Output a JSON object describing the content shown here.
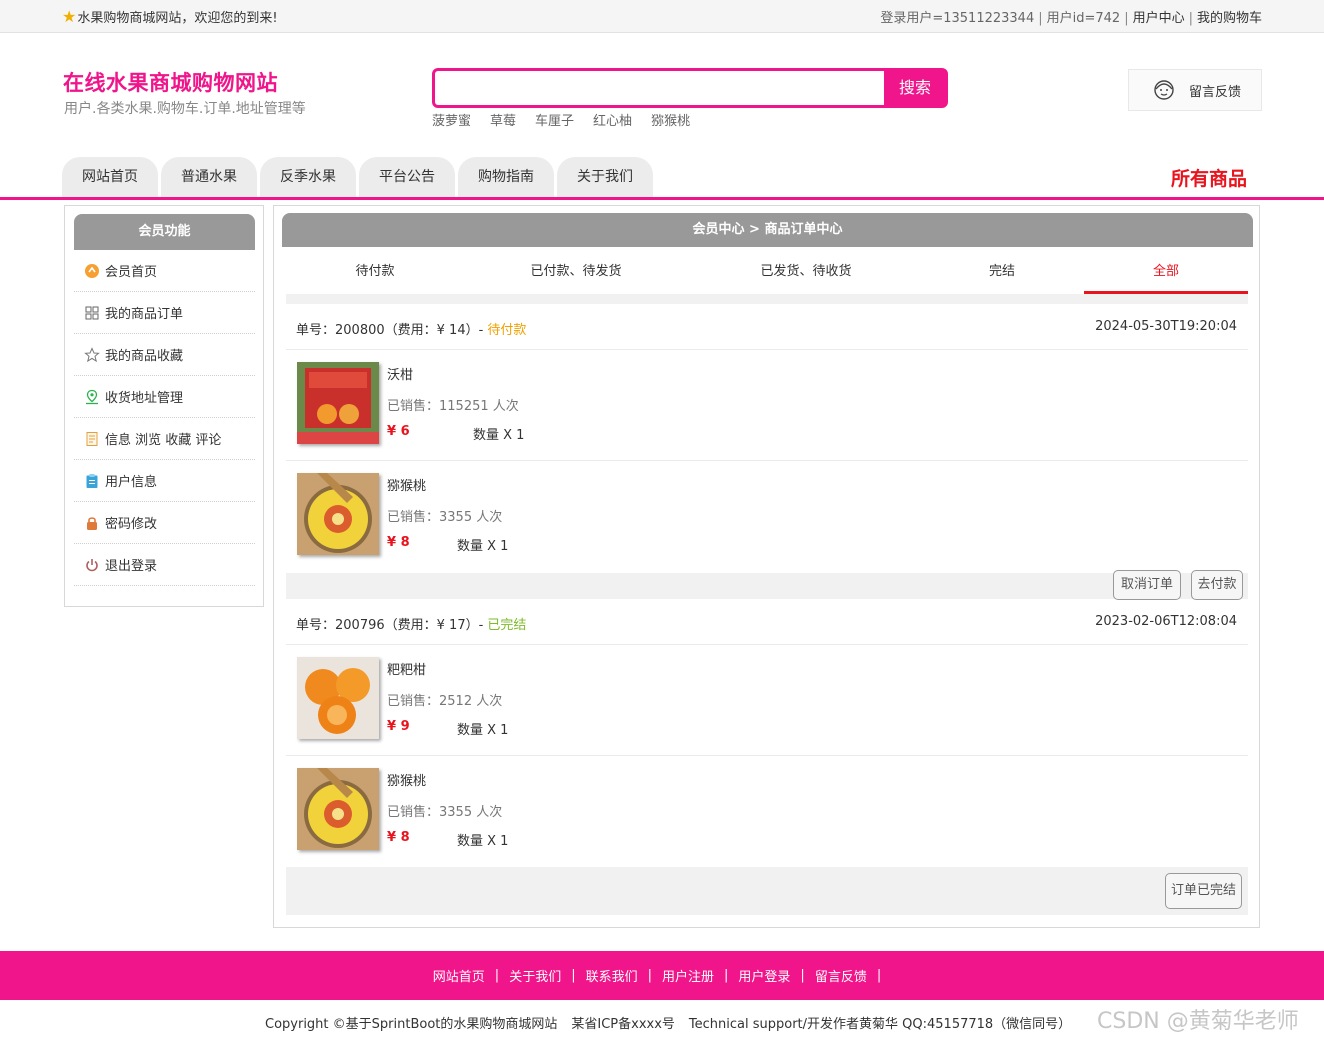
{
  "topbar": {
    "welcome": "水果购物商城网站，欢迎您的到来!",
    "login_user": "登录用户=13511223344",
    "user_id": "用户id=742",
    "user_center": "用户中心",
    "my_cart": "我的购物车"
  },
  "header": {
    "title": "在线水果商城购物网站",
    "subtitle": "用户.各类水果.购物车.订单.地址管理等",
    "search_placeholder": "",
    "search_button": "搜索",
    "hot_words": [
      "菠萝蜜",
      "草莓",
      "车厘子",
      "红心柚",
      "猕猴桃"
    ],
    "feedback": "留言反馈"
  },
  "nav": {
    "tabs": [
      "网站首页",
      "普通水果",
      "反季水果",
      "平台公告",
      "购物指南",
      "关于我们"
    ],
    "all_goods": "所有商品"
  },
  "sidebar": {
    "title": "会员功能",
    "items": [
      {
        "label": "会员首页",
        "icon": "member-home-icon"
      },
      {
        "label": "我的商品订单",
        "icon": "orders-grid-icon"
      },
      {
        "label": "我的商品收藏",
        "icon": "star-outline-icon"
      },
      {
        "label": "收货地址管理",
        "icon": "location-pin-icon"
      },
      {
        "label": "信息 浏览 收藏 评论",
        "icon": "document-icon"
      },
      {
        "label": "用户信息",
        "icon": "clipboard-icon"
      },
      {
        "label": "密码修改",
        "icon": "lock-icon"
      },
      {
        "label": "退出登录",
        "icon": "power-icon"
      }
    ]
  },
  "main": {
    "breadcrumb": "会员中心 > 商品订单中心",
    "tabs": [
      "待付款",
      "已付款、待发货",
      "已发货、待收货",
      "完结",
      "全部"
    ],
    "active_tab": "全部",
    "orders": [
      {
        "no_label": "单号：200800",
        "fee_label": "（费用：¥ 14）- ",
        "status": "待付款",
        "date": "2024-05-30T19:20:04",
        "items": [
          {
            "name": "沃柑",
            "sold": "已销售：115251 人次",
            "price": "¥ 6",
            "qty": "数量 X 1"
          },
          {
            "name": "猕猴桃",
            "sold": "已销售：3355 人次",
            "price": "¥ 8",
            "qty": "数量 X 1"
          }
        ],
        "buttons": [
          "取消订单",
          "去付款"
        ]
      },
      {
        "no_label": "单号：200796",
        "fee_label": "（费用：¥ 17）- ",
        "status": "已完结",
        "date": "2023-02-06T12:08:04",
        "items": [
          {
            "name": "粑粑柑",
            "sold": "已销售：2512 人次",
            "price": "¥ 9",
            "qty": "数量 X 1"
          },
          {
            "name": "猕猴桃",
            "sold": "已销售：3355 人次",
            "price": "¥ 8",
            "qty": "数量 X 1"
          }
        ],
        "buttons": [
          "订单已完结"
        ]
      }
    ]
  },
  "footer": {
    "links": [
      "网站首页",
      "关于我们",
      "联系我们",
      "用户注册",
      "用户登录",
      "留言反馈"
    ],
    "copyright": "Copyright ©基于SprintBoot的水果购物商城网站",
    "icp": "某省ICP备xxxx号",
    "support": "Technical support/开发作者黄菊华 QQ:45157718（微信同号）",
    "watermark": "CSDN @黄菊华老师"
  },
  "colors": {
    "brand_pink": "#f0158a",
    "accent_red": "#e8141e",
    "status_pending": "#f0a000",
    "status_done": "#7cbb2a"
  }
}
